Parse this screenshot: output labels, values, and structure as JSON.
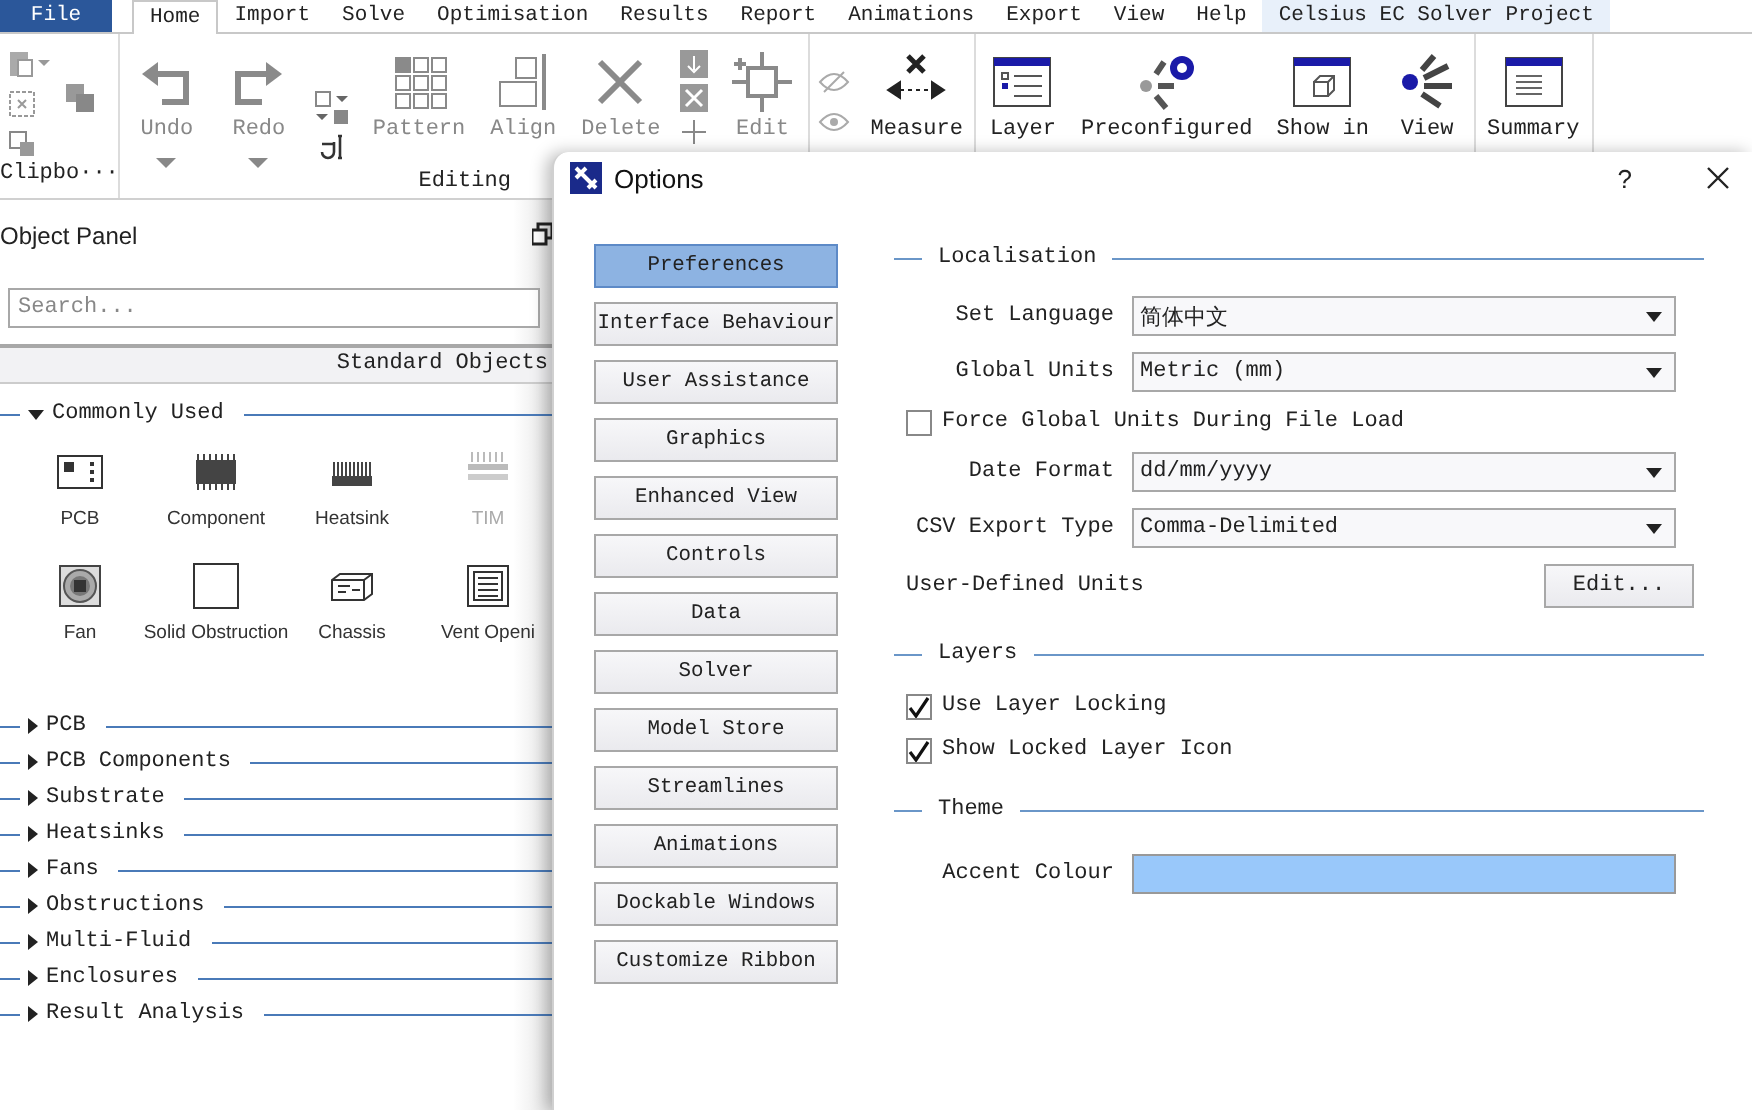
{
  "menu_tabs": [
    {
      "label": "File",
      "kind": "file",
      "selected": false
    },
    {
      "label": "Home",
      "kind": "tab",
      "selected": true
    },
    {
      "label": "Import",
      "kind": "tab",
      "selected": false
    },
    {
      "label": "Solve",
      "kind": "tab",
      "selected": false
    },
    {
      "label": "Optimisation",
      "kind": "tab",
      "selected": false
    },
    {
      "label": "Results",
      "kind": "tab",
      "selected": false
    },
    {
      "label": "Report",
      "kind": "tab",
      "selected": false
    },
    {
      "label": "Animations",
      "kind": "tab",
      "selected": false
    },
    {
      "label": "Export",
      "kind": "tab",
      "selected": false
    },
    {
      "label": "View",
      "kind": "tab",
      "selected": false
    },
    {
      "label": "Help",
      "kind": "tab",
      "selected": false
    },
    {
      "label": "Celsius EC Solver Project",
      "kind": "context",
      "selected": false
    }
  ],
  "ribbon": {
    "groups": [
      {
        "label": "Clipbo···",
        "buttons": [
          {
            "kind": "clipboard-tools"
          }
        ]
      },
      {
        "label": "Editing",
        "buttons": [
          {
            "kind": "undo",
            "label": "Undo",
            "disabled": true
          },
          {
            "kind": "redo",
            "label": "Redo",
            "disabled": true
          },
          {
            "kind": "text-tools"
          },
          {
            "kind": "pattern",
            "label": "Pattern",
            "disabled": true
          },
          {
            "kind": "align",
            "label": "Align",
            "disabled": true
          },
          {
            "kind": "delete",
            "label": "Delete",
            "disabled": true
          },
          {
            "kind": "stack-tools"
          },
          {
            "kind": "edit",
            "label": "Edit",
            "disabled": true
          }
        ]
      },
      {
        "buttons": [
          {
            "kind": "eye-tools"
          },
          {
            "kind": "measure",
            "label": "Measure",
            "disabled": false
          }
        ]
      },
      {
        "buttons": [
          {
            "kind": "layer",
            "label": "Layer",
            "disabled": false
          },
          {
            "kind": "preconfigured",
            "label": "Preconfigured",
            "disabled": false
          },
          {
            "kind": "show",
            "label": "Show in",
            "disabled": false
          },
          {
            "kind": "view",
            "label": "View",
            "disabled": false
          }
        ]
      },
      {
        "buttons": [
          {
            "kind": "summary",
            "label": "Summary",
            "disabled": false
          }
        ]
      }
    ]
  },
  "object_panel": {
    "title": "Object Panel",
    "search": {
      "placeholder": "Search..."
    },
    "tab": "Standard Objects",
    "groups": [
      {
        "label": "Commonly Used",
        "expanded": true,
        "items": [
          {
            "kind": "pcb",
            "label": "PCB",
            "disabled": false
          },
          {
            "kind": "component",
            "label": "Component",
            "disabled": false
          },
          {
            "kind": "heatsink",
            "label": "Heatsink",
            "disabled": false
          },
          {
            "kind": "tim",
            "label": "TIM",
            "disabled": true
          },
          {
            "kind": "fan",
            "label": "Fan",
            "disabled": false
          },
          {
            "kind": "obstruction",
            "label": "Solid Obstruction",
            "disabled": false
          },
          {
            "kind": "chassis",
            "label": "Chassis",
            "disabled": false
          },
          {
            "kind": "vent",
            "label": "Vent Openi",
            "disabled": false
          }
        ]
      },
      {
        "label": "PCB",
        "expanded": false
      },
      {
        "label": "PCB Components",
        "expanded": false
      },
      {
        "label": "Substrate",
        "expanded": false
      },
      {
        "label": "Heatsinks",
        "expanded": false
      },
      {
        "label": "Fans",
        "expanded": false
      },
      {
        "label": "Obstructions",
        "expanded": false
      },
      {
        "label": "Multi-Fluid",
        "expanded": false
      },
      {
        "label": "Enclosures",
        "expanded": false
      },
      {
        "label": "Result Analysis",
        "expanded": false
      }
    ]
  },
  "dialog": {
    "title": "Options",
    "help": "?",
    "nav": [
      {
        "label": "Preferences",
        "selected": true
      },
      {
        "label": "Interface Behaviour",
        "selected": false
      },
      {
        "label": "User Assistance",
        "selected": false
      },
      {
        "label": "Graphics",
        "selected": false
      },
      {
        "label": "Enhanced View",
        "selected": false
      },
      {
        "label": "Controls",
        "selected": false
      },
      {
        "label": "Data",
        "selected": false
      },
      {
        "label": "Solver",
        "selected": false
      },
      {
        "label": "Model Store",
        "selected": false
      },
      {
        "label": "Streamlines",
        "selected": false
      },
      {
        "label": "Animations",
        "selected": false
      },
      {
        "label": "Dockable Windows",
        "selected": false
      },
      {
        "label": "Customize Ribbon",
        "selected": false
      }
    ],
    "sections": [
      {
        "title": "Localisation",
        "rows": [
          {
            "kind": "select",
            "label": "Set Language",
            "value": "简体中文"
          },
          {
            "kind": "select",
            "label": "Global Units",
            "value": "Metric (mm)"
          },
          {
            "kind": "checkbox",
            "label": "Force Global Units During File Load",
            "checked": false
          },
          {
            "kind": "select",
            "label": "Date Format",
            "value": "dd/mm/yyyy"
          },
          {
            "kind": "select",
            "label": "CSV Export Type",
            "value": "Comma-Delimited"
          },
          {
            "kind": "button",
            "label": "User-Defined Units",
            "button": "Edit..."
          }
        ]
      },
      {
        "title": "Layers",
        "rows": [
          {
            "kind": "checkbox",
            "label": "Use Layer Locking",
            "checked": true
          },
          {
            "kind": "checkbox",
            "label": "Show Locked Layer Icon",
            "checked": true
          }
        ]
      },
      {
        "title": "Theme",
        "rows": [
          {
            "kind": "color",
            "label": "Accent Colour",
            "color": "#99c8fa"
          }
        ]
      }
    ]
  }
}
